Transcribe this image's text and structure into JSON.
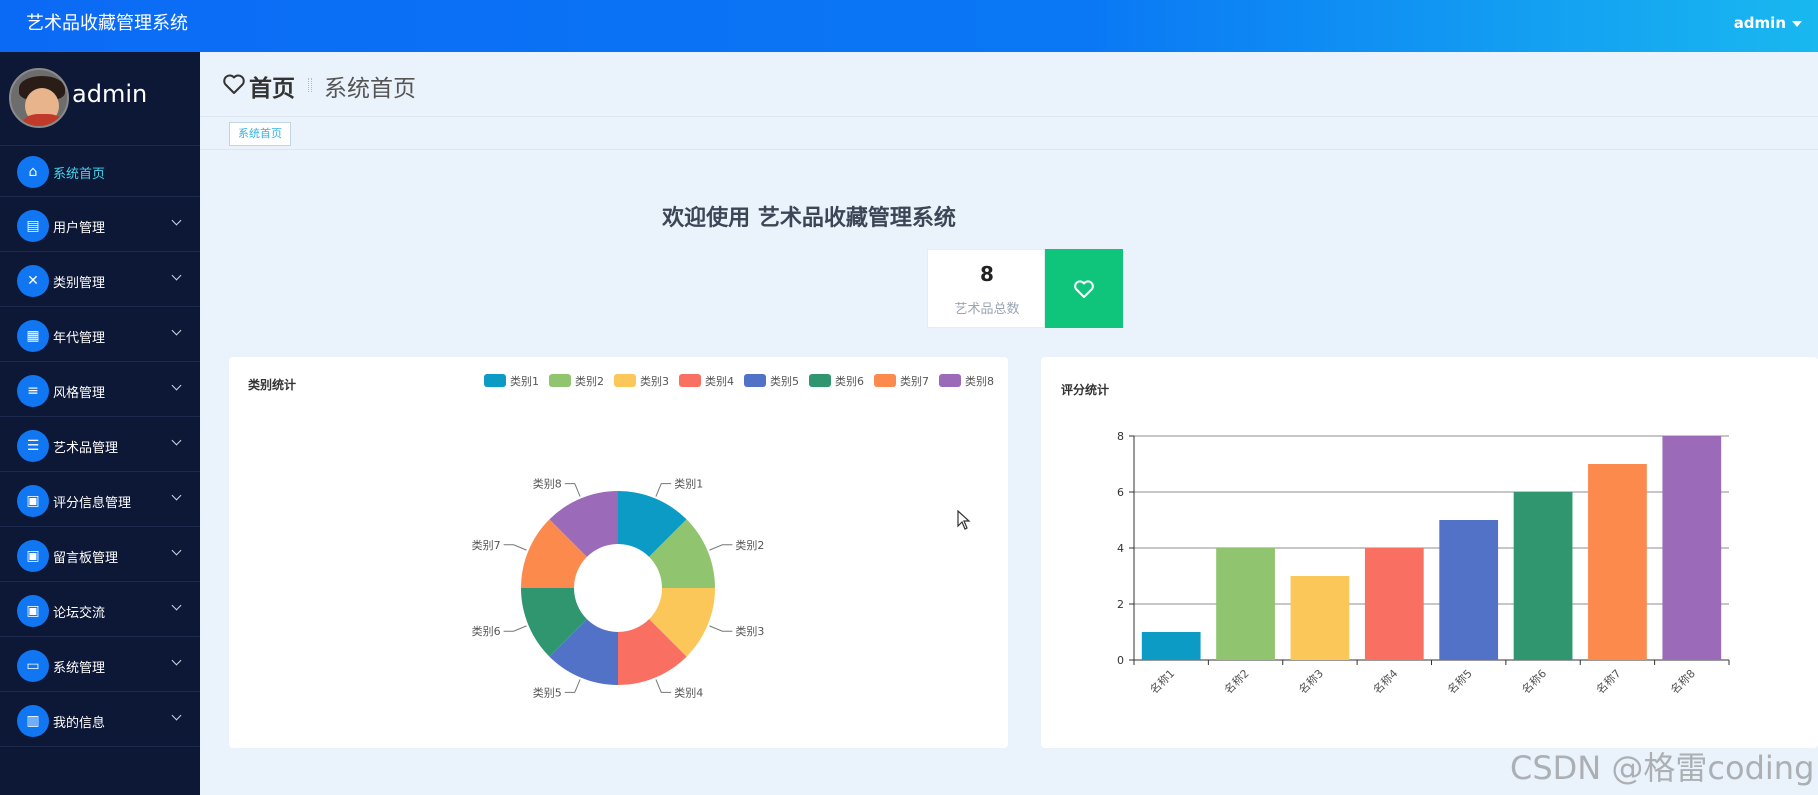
{
  "topbar": {
    "app_title": "艺术品收藏管理系统",
    "user": "admin"
  },
  "sidebar": {
    "username": "admin",
    "items": [
      {
        "label": "系统首页",
        "icon": "home-icon",
        "glyph": "⌂",
        "active": true,
        "has_children": false
      },
      {
        "label": "用户管理",
        "icon": "chart-icon",
        "glyph": "▤",
        "active": false,
        "has_children": true
      },
      {
        "label": "类别管理",
        "icon": "clipboard-icon",
        "glyph": "✕",
        "active": false,
        "has_children": true
      },
      {
        "label": "年代管理",
        "icon": "grid-icon",
        "glyph": "▦",
        "active": false,
        "has_children": true
      },
      {
        "label": "风格管理",
        "icon": "sliders-icon",
        "glyph": "≡",
        "active": false,
        "has_children": true
      },
      {
        "label": "艺术品管理",
        "icon": "list-icon",
        "glyph": "☰",
        "active": false,
        "has_children": true
      },
      {
        "label": "评分信息管理",
        "icon": "apps-icon",
        "glyph": "▣",
        "active": false,
        "has_children": true
      },
      {
        "label": "留言板管理",
        "icon": "apps-icon",
        "glyph": "▣",
        "active": false,
        "has_children": true
      },
      {
        "label": "论坛交流",
        "icon": "apps-icon",
        "glyph": "▣",
        "active": false,
        "has_children": true
      },
      {
        "label": "系统管理",
        "icon": "monitor-icon",
        "glyph": "▭",
        "active": false,
        "has_children": true
      },
      {
        "label": "我的信息",
        "icon": "card-icon",
        "glyph": "▥",
        "active": false,
        "has_children": true
      }
    ]
  },
  "page_header": {
    "title": "首页",
    "subtitle": "系统首页"
  },
  "tags": [
    {
      "label": "系统首页"
    }
  ],
  "welcome": "欢迎使用 艺术品收藏管理系统",
  "stat": {
    "value": "8",
    "label": "艺术品总数",
    "accent": "#0fc57b"
  },
  "palette": [
    "#0c9bc4",
    "#91c46f",
    "#fcc759",
    "#f96f61",
    "#5272c8",
    "#2f9670",
    "#fc8a4c",
    "#9b6ab8"
  ],
  "chart_data": [
    {
      "type": "pie",
      "title": "类别统计",
      "donut": true,
      "legend_position": "top-right",
      "categories": [
        "类别1",
        "类别2",
        "类别3",
        "类别4",
        "类别5",
        "类别6",
        "类别7",
        "类别8"
      ],
      "values": [
        1,
        1,
        1,
        1,
        1,
        1,
        1,
        1
      ]
    },
    {
      "type": "bar",
      "title": "评分统计",
      "categories": [
        "名称1",
        "名称2",
        "名称3",
        "名称4",
        "名称5",
        "名称6",
        "名称7",
        "名称8"
      ],
      "values": [
        1,
        4,
        3,
        4,
        5,
        6,
        7,
        8
      ],
      "ylim": [
        0,
        8
      ],
      "yticks": [
        0,
        2,
        4,
        6,
        8
      ],
      "grid": true
    }
  ],
  "watermark": "CSDN @格雷coding"
}
